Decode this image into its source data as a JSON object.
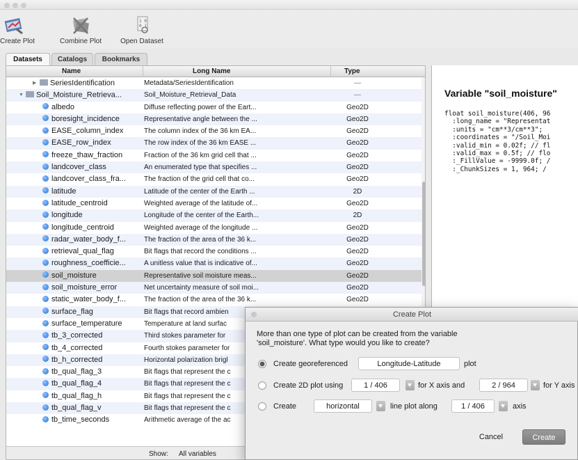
{
  "toolbar": {
    "create_plot": "Create Plot",
    "combine_plot": "Combine Plot",
    "open_dataset": "Open Dataset"
  },
  "tabs": [
    "Datasets",
    "Catalogs",
    "Bookmarks"
  ],
  "table": {
    "headers": {
      "name": "Name",
      "long_name": "Long Name",
      "type": "Type"
    },
    "rows": [
      {
        "name": "SeriesIdentification",
        "long": "Metadata/SeriesIdentification",
        "type": "—",
        "kind": "folder",
        "expand": "▶"
      },
      {
        "name": "Soil_Moisture_Retrieva...",
        "long": "Soil_Moisture_Retrieval_Data",
        "type": "—",
        "kind": "folder",
        "expand": "▼"
      },
      {
        "name": "albedo",
        "long": "Diffuse reflecting power of the Eart...",
        "type": "Geo2D",
        "kind": "var"
      },
      {
        "name": "boresight_incidence",
        "long": "Representative angle between the ...",
        "type": "Geo2D",
        "kind": "var"
      },
      {
        "name": "EASE_column_index",
        "long": "The column index of the 36 km EA...",
        "type": "Geo2D",
        "kind": "var"
      },
      {
        "name": "EASE_row_index",
        "long": "The row index of the 36 km EASE ...",
        "type": "Geo2D",
        "kind": "var"
      },
      {
        "name": "freeze_thaw_fraction",
        "long": "Fraction of the 36 km grid cell that ...",
        "type": "Geo2D",
        "kind": "var"
      },
      {
        "name": "landcover_class",
        "long": "An enumerated type that specifies ...",
        "type": "Geo2D",
        "kind": "var"
      },
      {
        "name": "landcover_class_fra...",
        "long": "The fraction of the grid cell that co...",
        "type": "Geo2D",
        "kind": "var"
      },
      {
        "name": "latitude",
        "long": "Latitude of the center of the Earth ...",
        "type": "2D",
        "kind": "var"
      },
      {
        "name": "latitude_centroid",
        "long": "Weighted average of the latitude of...",
        "type": "Geo2D",
        "kind": "var"
      },
      {
        "name": "longitude",
        "long": "Longitude of the center of the Earth...",
        "type": "2D",
        "kind": "var"
      },
      {
        "name": "longitude_centroid",
        "long": "Weighted average of the longitude ...",
        "type": "Geo2D",
        "kind": "var"
      },
      {
        "name": "radar_water_body_f...",
        "long": "The fraction of the area of the 36 k...",
        "type": "Geo2D",
        "kind": "var"
      },
      {
        "name": "retrieval_qual_flag",
        "long": "Bit flags that record the conditions ...",
        "type": "Geo2D",
        "kind": "var"
      },
      {
        "name": "roughness_coefficie...",
        "long": "A unitless value that is indicative of...",
        "type": "Geo2D",
        "kind": "var"
      },
      {
        "name": "soil_moisture",
        "long": "Representative soil moisture meas...",
        "type": "Geo2D",
        "kind": "var",
        "selected": true
      },
      {
        "name": "soil_moisture_error",
        "long": "Net uncertainty measure of soil moi...",
        "type": "Geo2D",
        "kind": "var"
      },
      {
        "name": "static_water_body_f...",
        "long": "The fraction of the area of the 36 k...",
        "type": "Geo2D",
        "kind": "var"
      },
      {
        "name": "surface_flag",
        "long": "Bit flags that record ambien",
        "type": "",
        "kind": "var"
      },
      {
        "name": "surface_temperature",
        "long": "Temperature at land surfac",
        "type": "",
        "kind": "var"
      },
      {
        "name": "tb_3_corrected",
        "long": "Third stokes parameter for",
        "type": "",
        "kind": "var"
      },
      {
        "name": "tb_4_corrected",
        "long": "Fourth stokes parameter for",
        "type": "",
        "kind": "var"
      },
      {
        "name": "tb_h_corrected",
        "long": "Horizontal polarization brigl",
        "type": "",
        "kind": "var"
      },
      {
        "name": "tb_qual_flag_3",
        "long": "Bit flags that represent the c",
        "type": "",
        "kind": "var"
      },
      {
        "name": "tb_qual_flag_4",
        "long": "Bit flags that represent the c",
        "type": "",
        "kind": "var"
      },
      {
        "name": "tb_qual_flag_h",
        "long": "Bit flags that represent the c",
        "type": "",
        "kind": "var"
      },
      {
        "name": "tb_qual_flag_v",
        "long": "Bit flags that represent the c",
        "type": "",
        "kind": "var"
      },
      {
        "name": "tb_time_seconds",
        "long": "Arithmetic average of the ac",
        "type": "",
        "kind": "var"
      }
    ]
  },
  "footer": {
    "show_label": "Show:",
    "show_value": "All variables"
  },
  "detail": {
    "title": "Variable \"soil_moisture\"",
    "body": "float soil_moisture(406, 96\n  :long_name = \"Representat\n  :units = \"cm**3/cm**3\";\n  :coordinates = \"/Soil_Moi\n  :valid_min = 0.02f; // fl\n  :valid_max = 0.5f; // flo\n  :_FillValue = -9999.0f; /\n  :_ChunkSizes = 1, 964; /"
  },
  "dialog": {
    "title": "Create Plot",
    "message": "More than one type of plot can be created from the variable\n'soil_moisture'. What type would you like to create?",
    "opt1": {
      "prefix": "Create georeferenced",
      "combo": "Longitude-Latitude",
      "suffix": "plot",
      "selected": true
    },
    "opt2": {
      "prefix": "Create 2D plot using",
      "x": "1 / 406",
      "mid": "for X axis and",
      "y": "2 / 964",
      "suffix": "for Y axis"
    },
    "opt3": {
      "prefix": "Create",
      "combo": "horizontal",
      "mid": "line plot along",
      "axis": "1 / 406",
      "suffix": "axis"
    },
    "cancel": "Cancel",
    "create": "Create"
  }
}
